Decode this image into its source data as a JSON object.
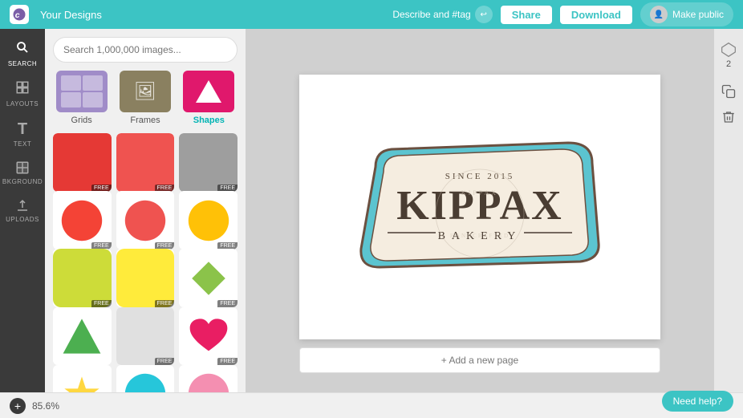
{
  "header": {
    "logo_text": "Canva",
    "page_title": "Your Designs",
    "describe_label": "Describe and #tag",
    "share_label": "Share",
    "download_label": "Download",
    "make_public_label": "Make public"
  },
  "sidebar": {
    "items": [
      {
        "id": "search",
        "label": "SEARCH",
        "icon": "🔍"
      },
      {
        "id": "layouts",
        "label": "LAYOUTS",
        "icon": "⊞"
      },
      {
        "id": "text",
        "label": "TEXT",
        "icon": "T"
      },
      {
        "id": "background",
        "label": "BKGROUND",
        "icon": "▦"
      },
      {
        "id": "uploads",
        "label": "UPLOADS",
        "icon": "↑"
      }
    ]
  },
  "panel": {
    "search_placeholder": "Search 1,000,000 images...",
    "categories": [
      {
        "id": "grids",
        "label": "Grids",
        "active": false
      },
      {
        "id": "frames",
        "label": "Frames",
        "active": false
      },
      {
        "id": "shapes",
        "label": "Shapes",
        "active": true
      }
    ],
    "shapes": [
      {
        "type": "rounded-rect",
        "color": "#e53935",
        "free": true
      },
      {
        "type": "rounded-rect",
        "color": "#ef5350",
        "free": true
      },
      {
        "type": "rounded-rect",
        "color": "#9e9e9e",
        "free": true
      },
      {
        "type": "circle",
        "color": "#f44336",
        "free": true
      },
      {
        "type": "circle",
        "color": "#ef5350",
        "free": true
      },
      {
        "type": "circle",
        "color": "#ffc107",
        "free": true
      },
      {
        "type": "rounded-rect",
        "color": "#cddc39",
        "free": true
      },
      {
        "type": "rounded-rect",
        "color": "#ffeb3b",
        "free": true
      },
      {
        "type": "diamond",
        "color": "#8bc34a",
        "free": true
      },
      {
        "type": "triangle",
        "color": "#4caf50",
        "free": false
      },
      {
        "type": "rounded-rect",
        "color": "#e0e0e0",
        "free": true
      },
      {
        "type": "heart",
        "color": "#e91e63",
        "free": true
      },
      {
        "type": "star",
        "color": "#ffd740",
        "free": false
      },
      {
        "type": "circle",
        "color": "#26c6da",
        "free": false
      },
      {
        "type": "circle",
        "color": "#f48fb1",
        "free": false
      }
    ]
  },
  "canvas": {
    "page_label": "+ Add a new page",
    "zoom_level": "85.6%"
  },
  "right_toolbar": {
    "page_number": "2",
    "copy_label": "Copy",
    "delete_label": "Delete"
  },
  "help_button": "Need help?"
}
